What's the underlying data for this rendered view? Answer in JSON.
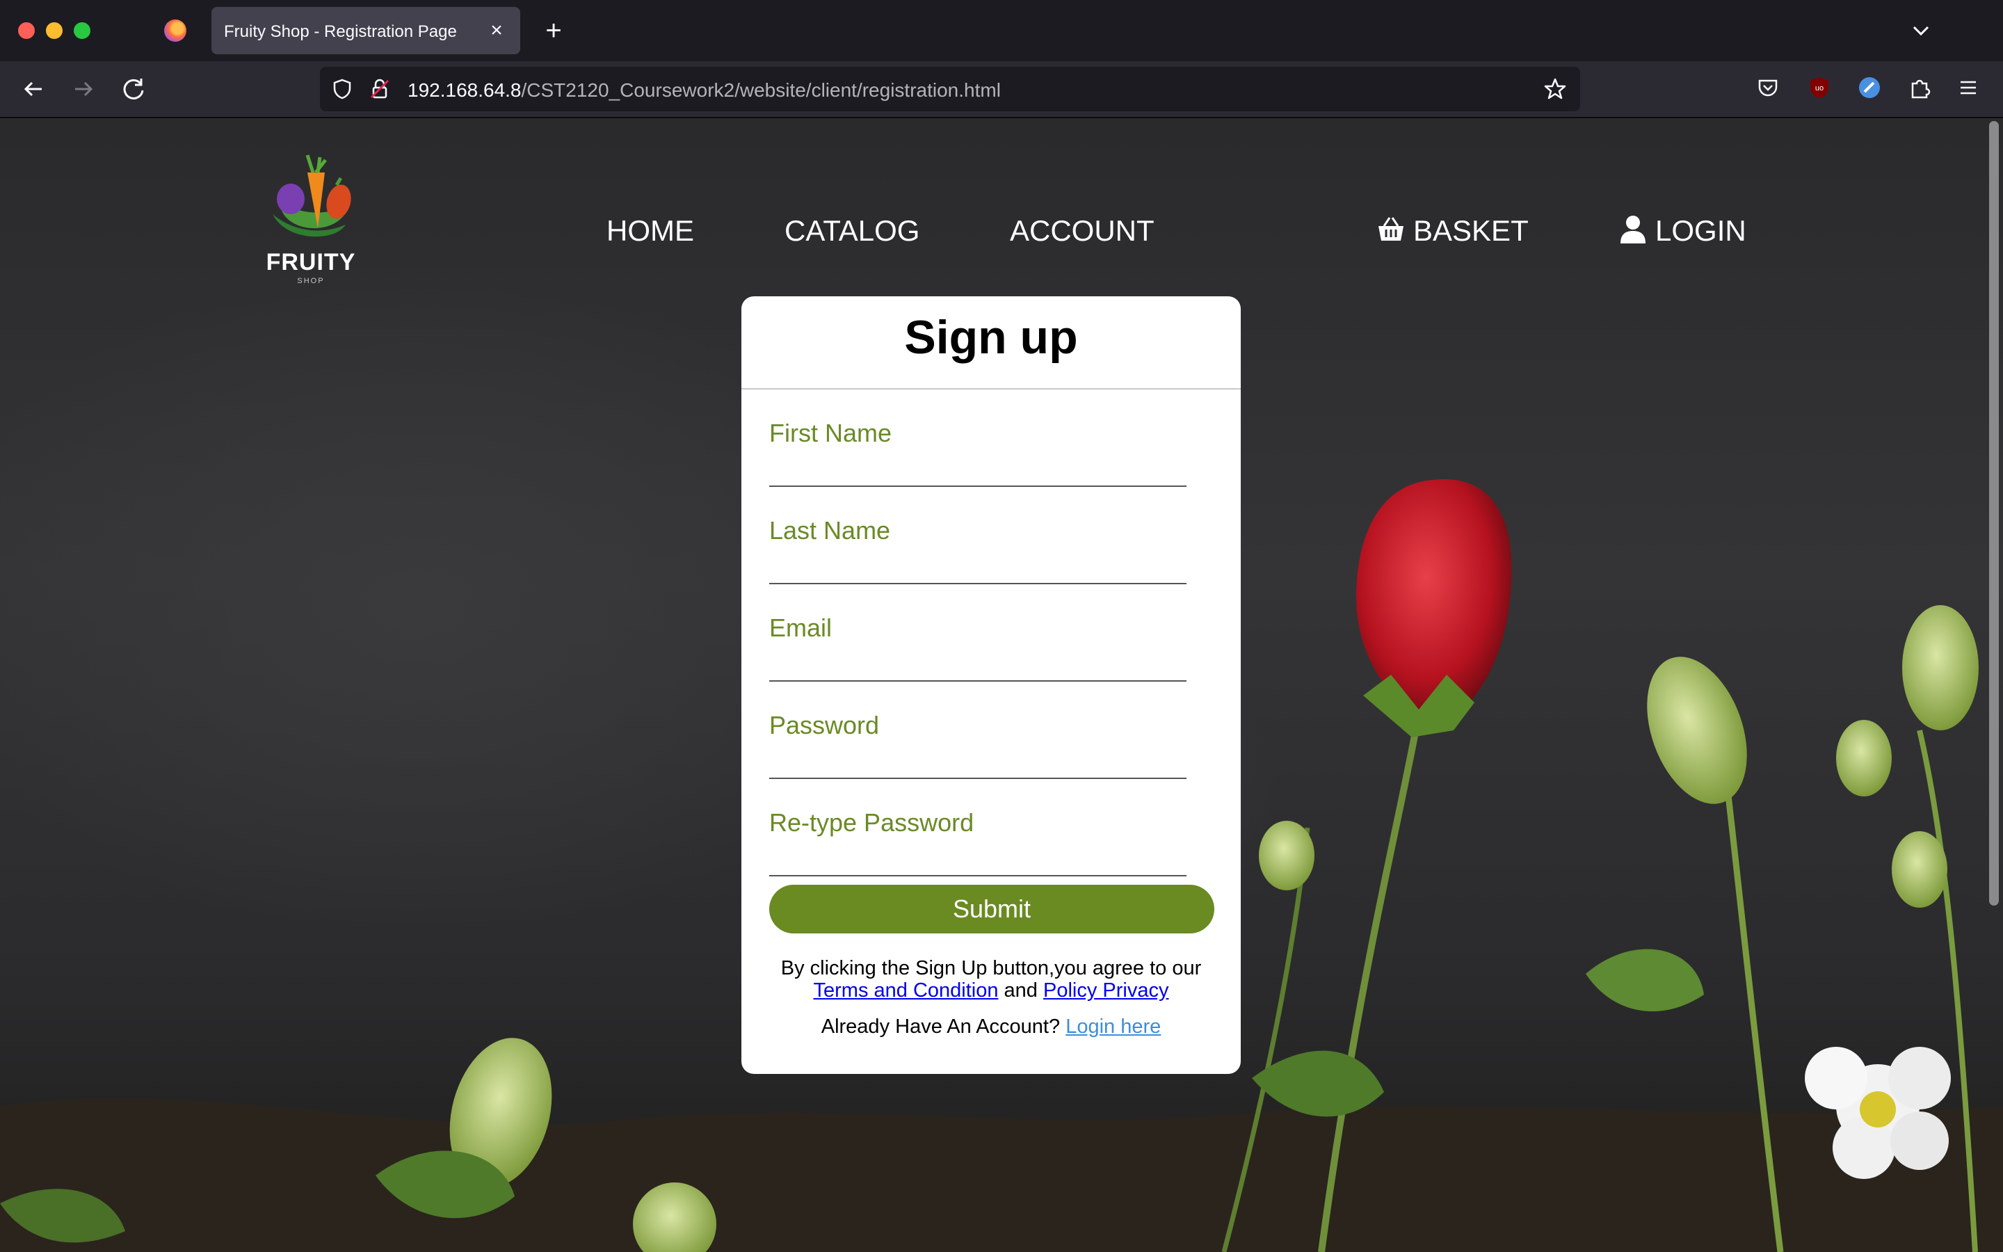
{
  "browser": {
    "tab_title": "Fruity Shop - Registration Page",
    "tab_close": "×",
    "new_tab": "+",
    "url_host": "192.168.64.8",
    "url_path": "/CST2120_Coursework2/website/client/registration.html"
  },
  "logo": {
    "word": "FRUITY",
    "sub": "SHOP"
  },
  "nav": {
    "home": "HOME",
    "catalog": "CATALOG",
    "account": "ACCOUNT",
    "basket": "BASKET",
    "login": "LOGIN"
  },
  "form": {
    "title": "Sign up",
    "fields": [
      {
        "label": "First Name",
        "value": ""
      },
      {
        "label": "Last Name",
        "value": ""
      },
      {
        "label": "Email",
        "value": ""
      },
      {
        "label": "Password",
        "value": ""
      },
      {
        "label": "Re-type Password",
        "value": ""
      }
    ],
    "submit": "Submit",
    "agree_text": "By clicking the Sign Up button,you agree to our",
    "terms_link": "Terms and Condition",
    "and_text": "and",
    "privacy_link": "Policy Privacy",
    "already_text": "Already Have An Account?",
    "login_link": "Login here"
  },
  "colors": {
    "accent_green": "#6a8a22",
    "label_green": "#6a8a25",
    "link_blue": "#0000ee"
  }
}
